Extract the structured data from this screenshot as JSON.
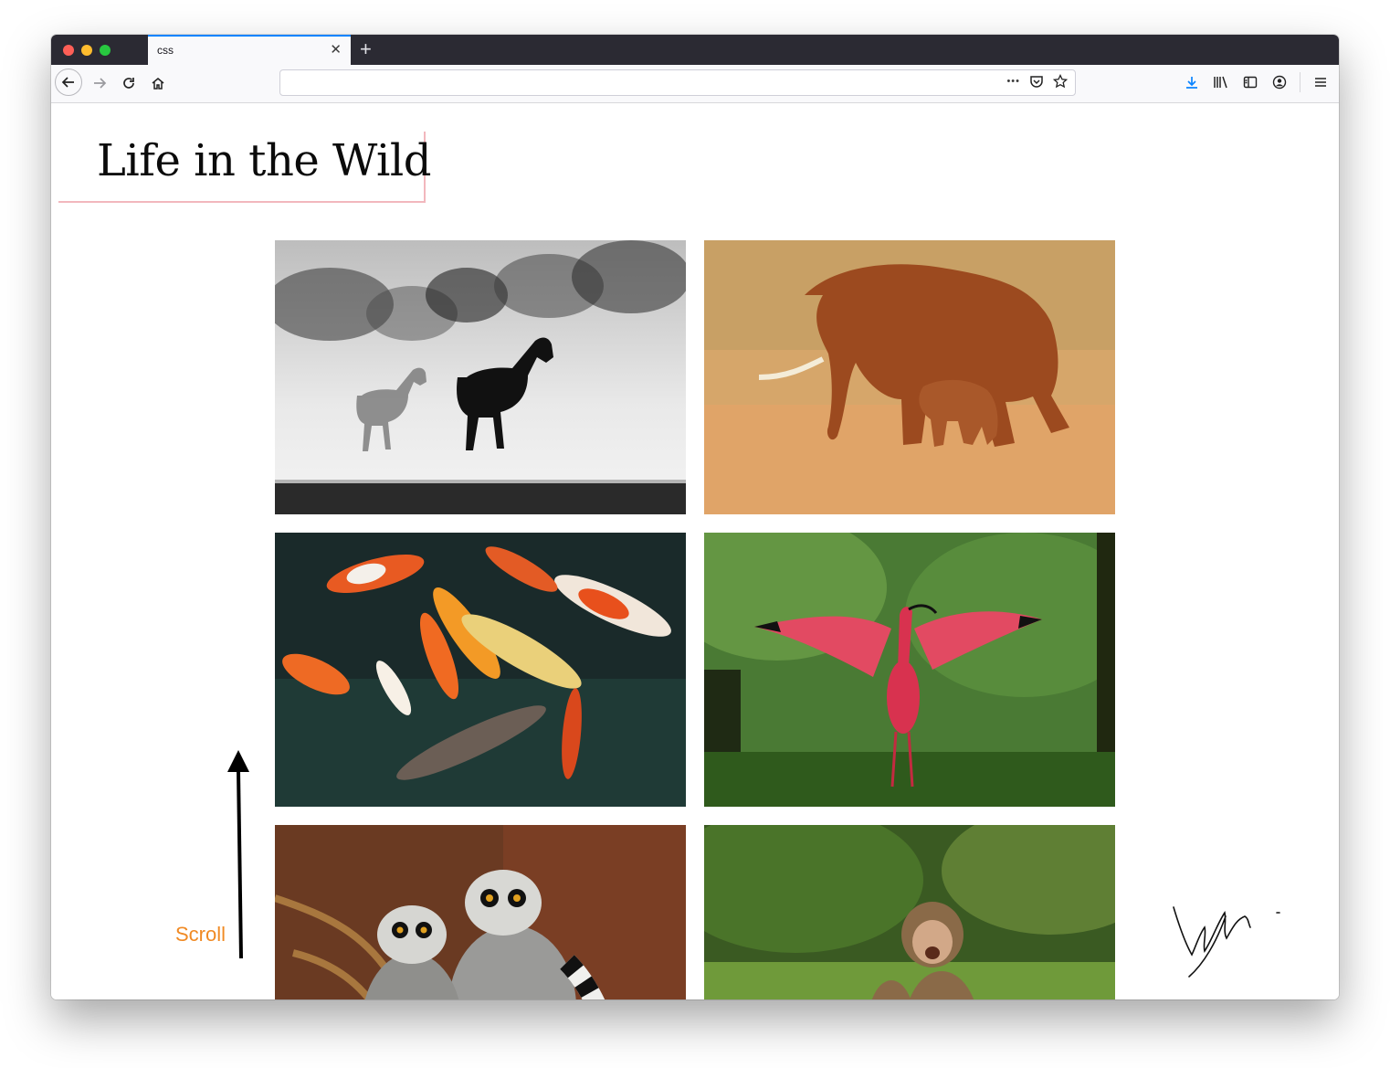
{
  "browser": {
    "tab_title": "css",
    "tab_close": "✕",
    "new_tab": "+",
    "url_value": "",
    "url_more": "•••"
  },
  "page": {
    "heading": "Life in the Wild",
    "scroll_label": "Scroll",
    "gallery": [
      {
        "name": "horses"
      },
      {
        "name": "elephants"
      },
      {
        "name": "koi-fish"
      },
      {
        "name": "scarlet-ibis"
      },
      {
        "name": "lemurs"
      },
      {
        "name": "monkey"
      }
    ]
  },
  "colors": {
    "tab_accent": "#0a84ff",
    "title_border": "#f2b7bd",
    "scroll_label": "#f08a24"
  }
}
